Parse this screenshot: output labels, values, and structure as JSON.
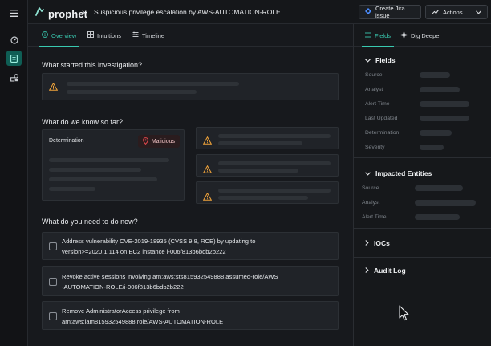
{
  "app": {
    "brand": "prophet",
    "breadcrumb_sep": "›",
    "title": "Suspicious privilege escalation by AWS-AUTOMATION-ROLE"
  },
  "toolbar": {
    "jira_label": "Create Jira issue",
    "actions_label": "Actions"
  },
  "tabs": [
    {
      "label": "Overview",
      "icon": "info-icon",
      "active": true
    },
    {
      "label": "Intuitions",
      "icon": "grid-icon",
      "active": false
    },
    {
      "label": "Timeline",
      "icon": "timeline-icon",
      "active": false
    }
  ],
  "sections": {
    "started": "What started this investigation?",
    "known": "What do we know so far?",
    "todo": "What do you need to do now?"
  },
  "determination": {
    "label": "Determination",
    "value": "Malicious"
  },
  "tasks": [
    {
      "line1": "Address vulnerability CVE-2019-18935 (CVSS 9.8, RCE) by updating to",
      "line2": "version>=2020.1.114 on EC2 instance i-006f813b6bdb2b222"
    },
    {
      "line1": "Revoke active sessions involving arn:aws:sts815932549888:assumed-role/AWS",
      "line2": "-AUTOMATION-ROLE/i-006f813b6bdb2b222"
    },
    {
      "line1": "Remove AdministratorAccess privilege from",
      "line2": "arn:aws:iam815932549888:role/AWS-AUTOMATION-ROLE"
    }
  ],
  "panel": {
    "tabs": [
      {
        "label": "Fields",
        "icon": "list-icon",
        "active": true
      },
      {
        "label": "Dig Deeper",
        "icon": "sparkle-icon",
        "active": false
      }
    ],
    "fields_title": "Fields",
    "fields": [
      "Source",
      "Analyst",
      "Alert Time",
      "Last Updated",
      "Determination",
      "Severity"
    ],
    "impacted_title": "Impacted Entities",
    "impacted": [
      "Source",
      "Analyst",
      "Alert Time"
    ],
    "iocs_title": "IOCs",
    "audit_title": "Audit Log"
  },
  "colors": {
    "accent": "#39c9b0",
    "malicious": "#e5484d",
    "warning": "#f0a33a",
    "background": "#17191d"
  }
}
